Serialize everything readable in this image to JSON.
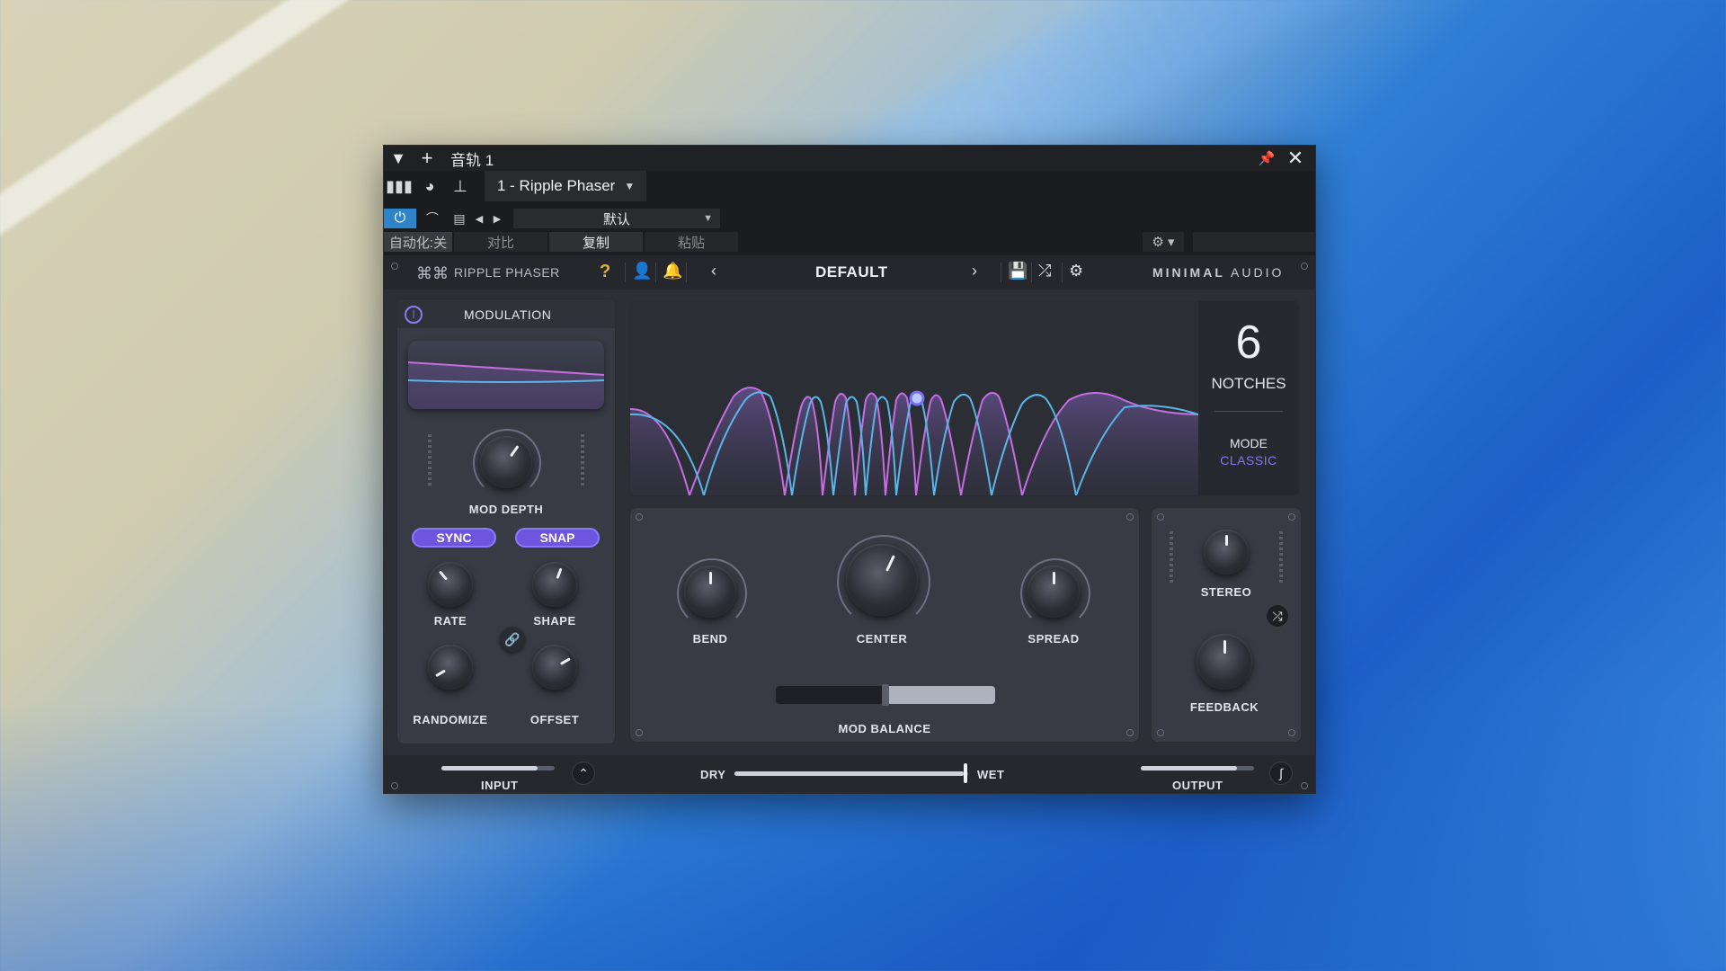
{
  "host": {
    "track_title": "音轨 1",
    "plugin_select": "1 - Ripple Phaser",
    "preset": "默认",
    "automation": "自动化:关",
    "compare": "对比",
    "copy": "复制",
    "paste": "粘贴"
  },
  "plugin": {
    "name": "RIPPLE PHASER",
    "help": "?",
    "preset": "DEFAULT",
    "logo_bold": "MINIMAL",
    "logo_light": "AUDIO"
  },
  "modulation": {
    "title": "MODULATION",
    "mod_depth": "MOD DEPTH",
    "sync": "SYNC",
    "snap": "SNAP",
    "rate": "RATE",
    "shape": "SHAPE",
    "randomize": "RANDOMIZE",
    "offset": "OFFSET"
  },
  "display": {
    "notches_value": "6",
    "notches_label": "NOTCHES",
    "mode_label": "MODE",
    "mode_value": "CLASSIC"
  },
  "controls": {
    "bend": "BEND",
    "center": "CENTER",
    "spread": "SPREAD",
    "mod_balance": "MOD BALANCE",
    "stereo": "STEREO",
    "feedback": "FEEDBACK"
  },
  "bottom": {
    "input": "INPUT",
    "dry": "DRY",
    "wet": "WET",
    "output": "OUTPUT",
    "dry_wet_level": 0.98,
    "input_level": 0.85,
    "output_level": 0.85,
    "mod_balance_level": 0.5
  },
  "colors": {
    "accent": "#6d55e0",
    "mode_color": "#8476f3",
    "curve_pink": "#c46ee0",
    "curve_blue": "#59b6e6",
    "host_power": "#2e84c9",
    "help": "#e2b33b"
  }
}
